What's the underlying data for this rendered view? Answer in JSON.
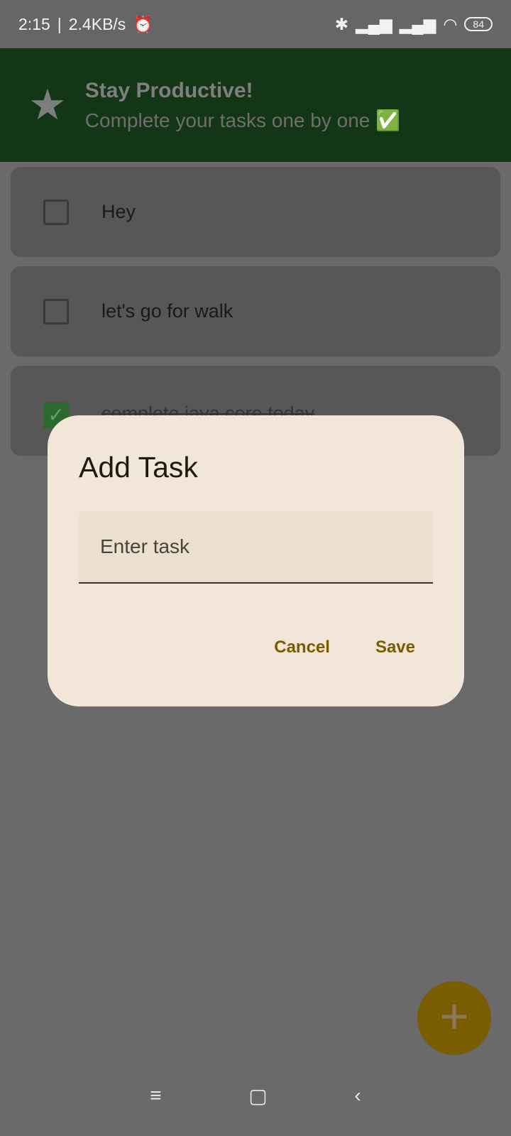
{
  "status": {
    "time": "2:15",
    "speed": "2.4KB/s",
    "battery": "84"
  },
  "header": {
    "title": "Stay Productive!",
    "subtitle": "Complete your tasks one by one ✅"
  },
  "tasks": [
    {
      "text": "Hey",
      "done": false
    },
    {
      "text": "let's go for walk",
      "done": false
    },
    {
      "text": "complete java core today",
      "done": true
    }
  ],
  "dialog": {
    "title": "Add Task",
    "placeholder": "Enter task",
    "cancel": "Cancel",
    "save": "Save"
  },
  "fab": {
    "label": "+"
  }
}
